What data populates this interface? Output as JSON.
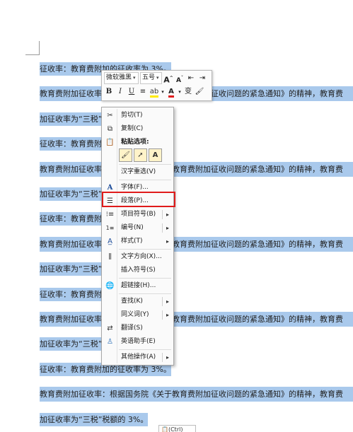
{
  "document": {
    "lines": [
      {
        "text": "征收率：教育费附加的征收率为 3%。",
        "full": false
      },
      {
        "text": "教育费附加征收率：根据国务院《关于教育费附加征收问题的紧急通知》的精神，教育费",
        "full": true
      },
      {
        "text": "加征收率为“三税”税额的 3%。",
        "full": false
      },
      {
        "text": "征收率：教育费附加的征收率为 3%。",
        "full": false
      },
      {
        "text": "教育费附加征收率：根据国务院《关于教育费附加征收问题的紧急通知》的精神，教育费",
        "full": true
      },
      {
        "text": "加征收率为“三税”税额的 3%。",
        "full": false
      },
      {
        "text": "征收率：教育费附加的征收率为 3%。",
        "full": false
      },
      {
        "text": "教育费附加征收率：根据国务院《关于教育费附加征收问题的紧急通知》的精神，教育费",
        "full": true
      },
      {
        "text": "加征收率为“三税”税额的 3%。",
        "full": false
      },
      {
        "text": "征收率：教育费附加的征收率为 3%。",
        "full": false
      },
      {
        "text": "教育费附加征收率：根据国务院《关于教育费附加征收问题的紧急通知》的精神，教育费",
        "full": true
      },
      {
        "text": "加征收率为“三税”税额的 3%。",
        "full": false
      },
      {
        "text": "征收率：教育费附加的征收率为 3%。",
        "full": false
      },
      {
        "text": "教育费附加征收率：根据国务院《关于教育费附加征收问题的紧急通知》的精神，教育费",
        "full": true
      },
      {
        "text": "加征收率为“三税”税额的 3%。",
        "full": false
      }
    ]
  },
  "mini_toolbar": {
    "font_name": "微软雅黑",
    "font_size": "五号",
    "grow_font": "A",
    "shrink_font": "A",
    "bold": "B",
    "italic": "I",
    "underline": "U",
    "font_color_letter": "A",
    "phonetic": "变"
  },
  "context_menu": {
    "cut": "剪切(T)",
    "copy": "复制(C)",
    "paste_options": "粘贴选项:",
    "paste_text_only": "A",
    "hanzi_reselect": "汉字重选(V)",
    "font": "字体(F)...",
    "paragraph": "段落(P)...",
    "bullets": "项目符号(B)",
    "numbering": "编号(N)",
    "styles": "样式(T)",
    "text_direction": "文字方向(X)...",
    "insert_symbol": "插入符号(S)",
    "hyperlink": "超链接(H)...",
    "lookup": "查找(K)",
    "synonyms": "同义词(Y)",
    "translate": "翻译(S)",
    "english_assistant": "英语助手(E)",
    "other_actions": "其他操作(A)"
  },
  "bottom_tip": "(Ctrl)",
  "colors": {
    "selection": "#a9c9ec",
    "highlight_box": "#e01b1b",
    "font_color": "#e01b1b"
  }
}
